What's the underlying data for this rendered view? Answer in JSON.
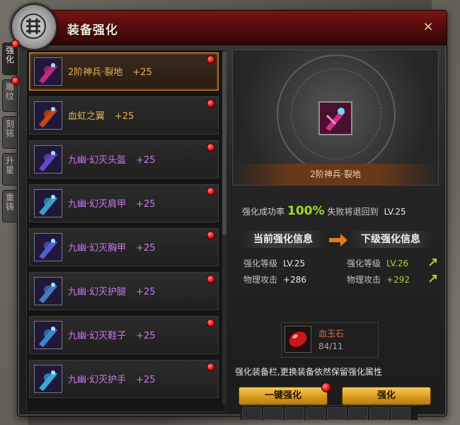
{
  "window": {
    "title": "装备强化",
    "close_label": "×"
  },
  "side_tabs": [
    {
      "label": "强化",
      "active": true,
      "alert": true
    },
    {
      "label": "雕纹",
      "active": false,
      "alert": true
    },
    {
      "label": "刻铭",
      "active": false,
      "alert": false
    },
    {
      "label": "升星",
      "active": false,
      "alert": false
    },
    {
      "label": "重铸",
      "active": false,
      "alert": false
    }
  ],
  "items": [
    {
      "name": "2阶神兵·裂地",
      "level": "+25",
      "color": "#e8b04a",
      "selected": true,
      "icon": "weapon-icon",
      "icon_color": "#c0287c"
    },
    {
      "name": "血虹之翼",
      "level": "+25",
      "color": "#e8b04a",
      "selected": false,
      "icon": "wings-icon",
      "icon_color": "#c84818"
    },
    {
      "name": "九幽·幻灭头盔",
      "level": "+25",
      "color": "#c878f0",
      "selected": false,
      "icon": "helmet-icon",
      "icon_color": "#6848c8"
    },
    {
      "name": "九幽·幻灭肩甲",
      "level": "+25",
      "color": "#c878f0",
      "selected": false,
      "icon": "shoulder-icon",
      "icon_color": "#3aa0c8"
    },
    {
      "name": "九幽·幻灭胸甲",
      "level": "+25",
      "color": "#c878f0",
      "selected": false,
      "icon": "chest-icon",
      "icon_color": "#5060d0"
    },
    {
      "name": "九幽·幻灭护腿",
      "level": "+25",
      "color": "#c878f0",
      "selected": false,
      "icon": "legs-icon",
      "icon_color": "#4a78c0"
    },
    {
      "name": "九幽·幻灭鞋子",
      "level": "+25",
      "color": "#c878f0",
      "selected": false,
      "icon": "boots-icon",
      "icon_color": "#3a88d0"
    },
    {
      "name": "九幽·幻灭护手",
      "level": "+25",
      "color": "#c878f0",
      "selected": false,
      "icon": "gloves-icon",
      "icon_color": "#38a8d8"
    }
  ],
  "detail": {
    "item_name": "2阶神兵·裂地",
    "success_label": "强化成功率",
    "success_value": "100%",
    "fail_label": "失败将退回到",
    "fail_level": "LV.25",
    "current_header": "当前强化信息",
    "next_header": "下级强化信息",
    "stats": {
      "current_level_label": "强化等级",
      "current_level": "LV.25",
      "current_attack_label": "物理攻击",
      "current_attack": "+286",
      "next_level_label": "强化等级",
      "next_level": "LV.26",
      "next_attack_label": "物理攻击",
      "next_attack": "+292"
    }
  },
  "material": {
    "name": "血玉石",
    "count": "84/11"
  },
  "note": "强化装备栏,更换装备依然保留强化属性",
  "buttons": {
    "one_click": "一键强化",
    "enhance": "强化"
  },
  "colors": {
    "accent_green": "#9cdc28",
    "title_red": "#7a1414",
    "button_gold": "#d79a1c"
  }
}
